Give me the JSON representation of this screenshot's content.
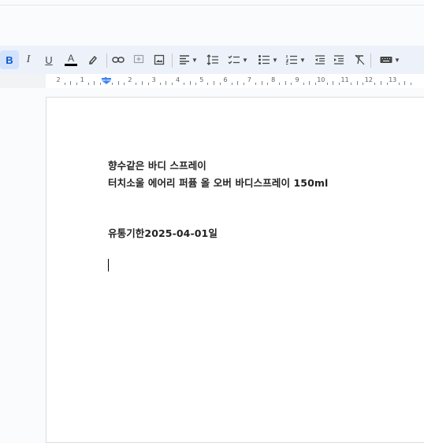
{
  "toolbar": {
    "bold": "B",
    "italic": "I",
    "underline": "U",
    "text_color": "A",
    "text_color_value": "#000000",
    "icons": [
      "bold-icon",
      "italic-icon",
      "underline-icon",
      "text-color-icon",
      "highlight-icon",
      "link-icon",
      "comment-icon",
      "image-icon",
      "align-icon",
      "line-spacing-icon",
      "checklist-icon",
      "bulleted-list-icon",
      "numbered-list-icon",
      "decrease-indent-icon",
      "increase-indent-icon",
      "clear-formatting-icon",
      "input-tools-icon"
    ]
  },
  "ruler": {
    "numbers": [
      "2",
      "1",
      "1",
      "2",
      "3",
      "4",
      "5",
      "6",
      "7",
      "8",
      "9",
      "10",
      "11",
      "12",
      "13"
    ]
  },
  "document": {
    "line1": "향수같은 바디 스프레이",
    "line2": "터치소울 에어리 퍼퓸 올 오버 바디스프레이 150ml",
    "line3": "유통기한2025-04-01일"
  },
  "colors": {
    "toolbar_bg": "#edf2fa",
    "active_bg": "#d3e3fd",
    "page_bg": "#ffffff",
    "canvas_bg": "#f9fbfd"
  }
}
